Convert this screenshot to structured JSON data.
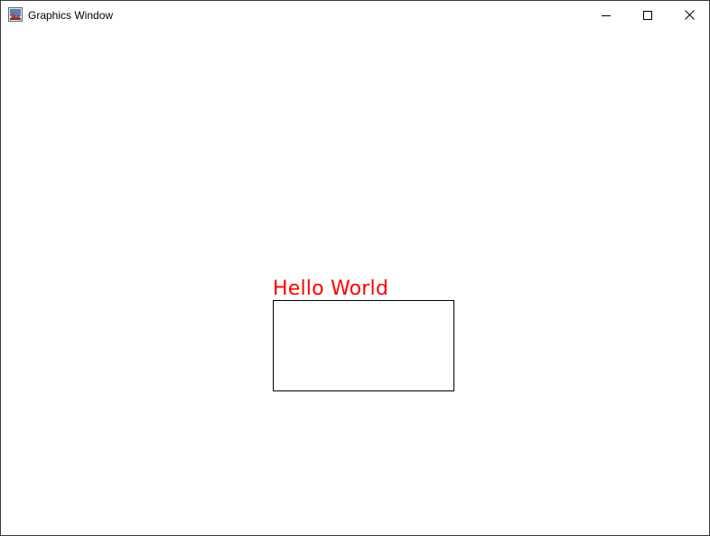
{
  "window": {
    "title": "Graphics Window",
    "icon": "java-app-icon",
    "controls": {
      "minimize_icon": "minimize-icon",
      "maximize_icon": "maximize-icon",
      "close_icon": "close-icon"
    }
  },
  "canvas": {
    "text": "Hello World",
    "text_color": "#ff0000",
    "shape": "rectangle",
    "shape_stroke": "#000000",
    "background": "#ffffff"
  }
}
